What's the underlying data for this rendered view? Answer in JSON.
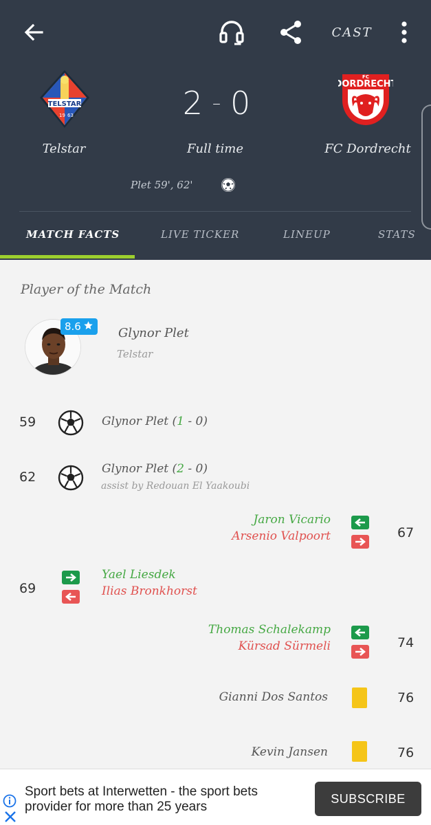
{
  "topbar": {
    "cast_label": "CAST"
  },
  "match": {
    "home_team": "Telstar",
    "away_team": "FC Dordrecht",
    "home_score": "2",
    "away_score": "0",
    "status": "Full time",
    "home_scorers": "Plet 59', 62'"
  },
  "tabs": [
    {
      "label": "MATCH FACTS",
      "active": true
    },
    {
      "label": "LIVE TICKER",
      "active": false
    },
    {
      "label": "LINEUP",
      "active": false
    },
    {
      "label": "STATS",
      "active": false
    }
  ],
  "potm": {
    "section_title": "Player of the Match",
    "rating": "8.6",
    "name": "Glynor Plet",
    "team": "Telstar"
  },
  "events": {
    "goal1": {
      "minute": "59",
      "player": "Glynor Plet (",
      "score_home": "1",
      "score_rest": " - 0)"
    },
    "goal2": {
      "minute": "62",
      "player": "Glynor Plet (",
      "score_home": "2",
      "score_rest": " - 0)",
      "assist": "assist by Redouan El Yaakoubi"
    },
    "sub1": {
      "minute": "67",
      "player_in": "Jaron Vicario",
      "player_out": "Arsenio Valpoort"
    },
    "sub2": {
      "minute": "69",
      "player_in": "Yael Liesdek",
      "player_out": "Ilias Bronkhorst"
    },
    "sub3": {
      "minute": "74",
      "player_in": "Thomas Schalekamp",
      "player_out": "Kürsad Sürmeli"
    },
    "card1": {
      "minute": "76",
      "player": "Gianni Dos Santos"
    },
    "card2": {
      "minute": "76",
      "player": "Kevin Jansen"
    }
  },
  "ad": {
    "text": "Sport bets at Interwetten - the sport bets provider for more than 25 years",
    "button": "SUBSCRIBE"
  },
  "colors": {
    "header_bg": "#323b48",
    "tab_indicator": "#9dcf2e",
    "rating_badge": "#1aa0ec",
    "sub_in": "#45a843",
    "sub_out": "#e0514f",
    "yellow_card": "#f5c518"
  }
}
